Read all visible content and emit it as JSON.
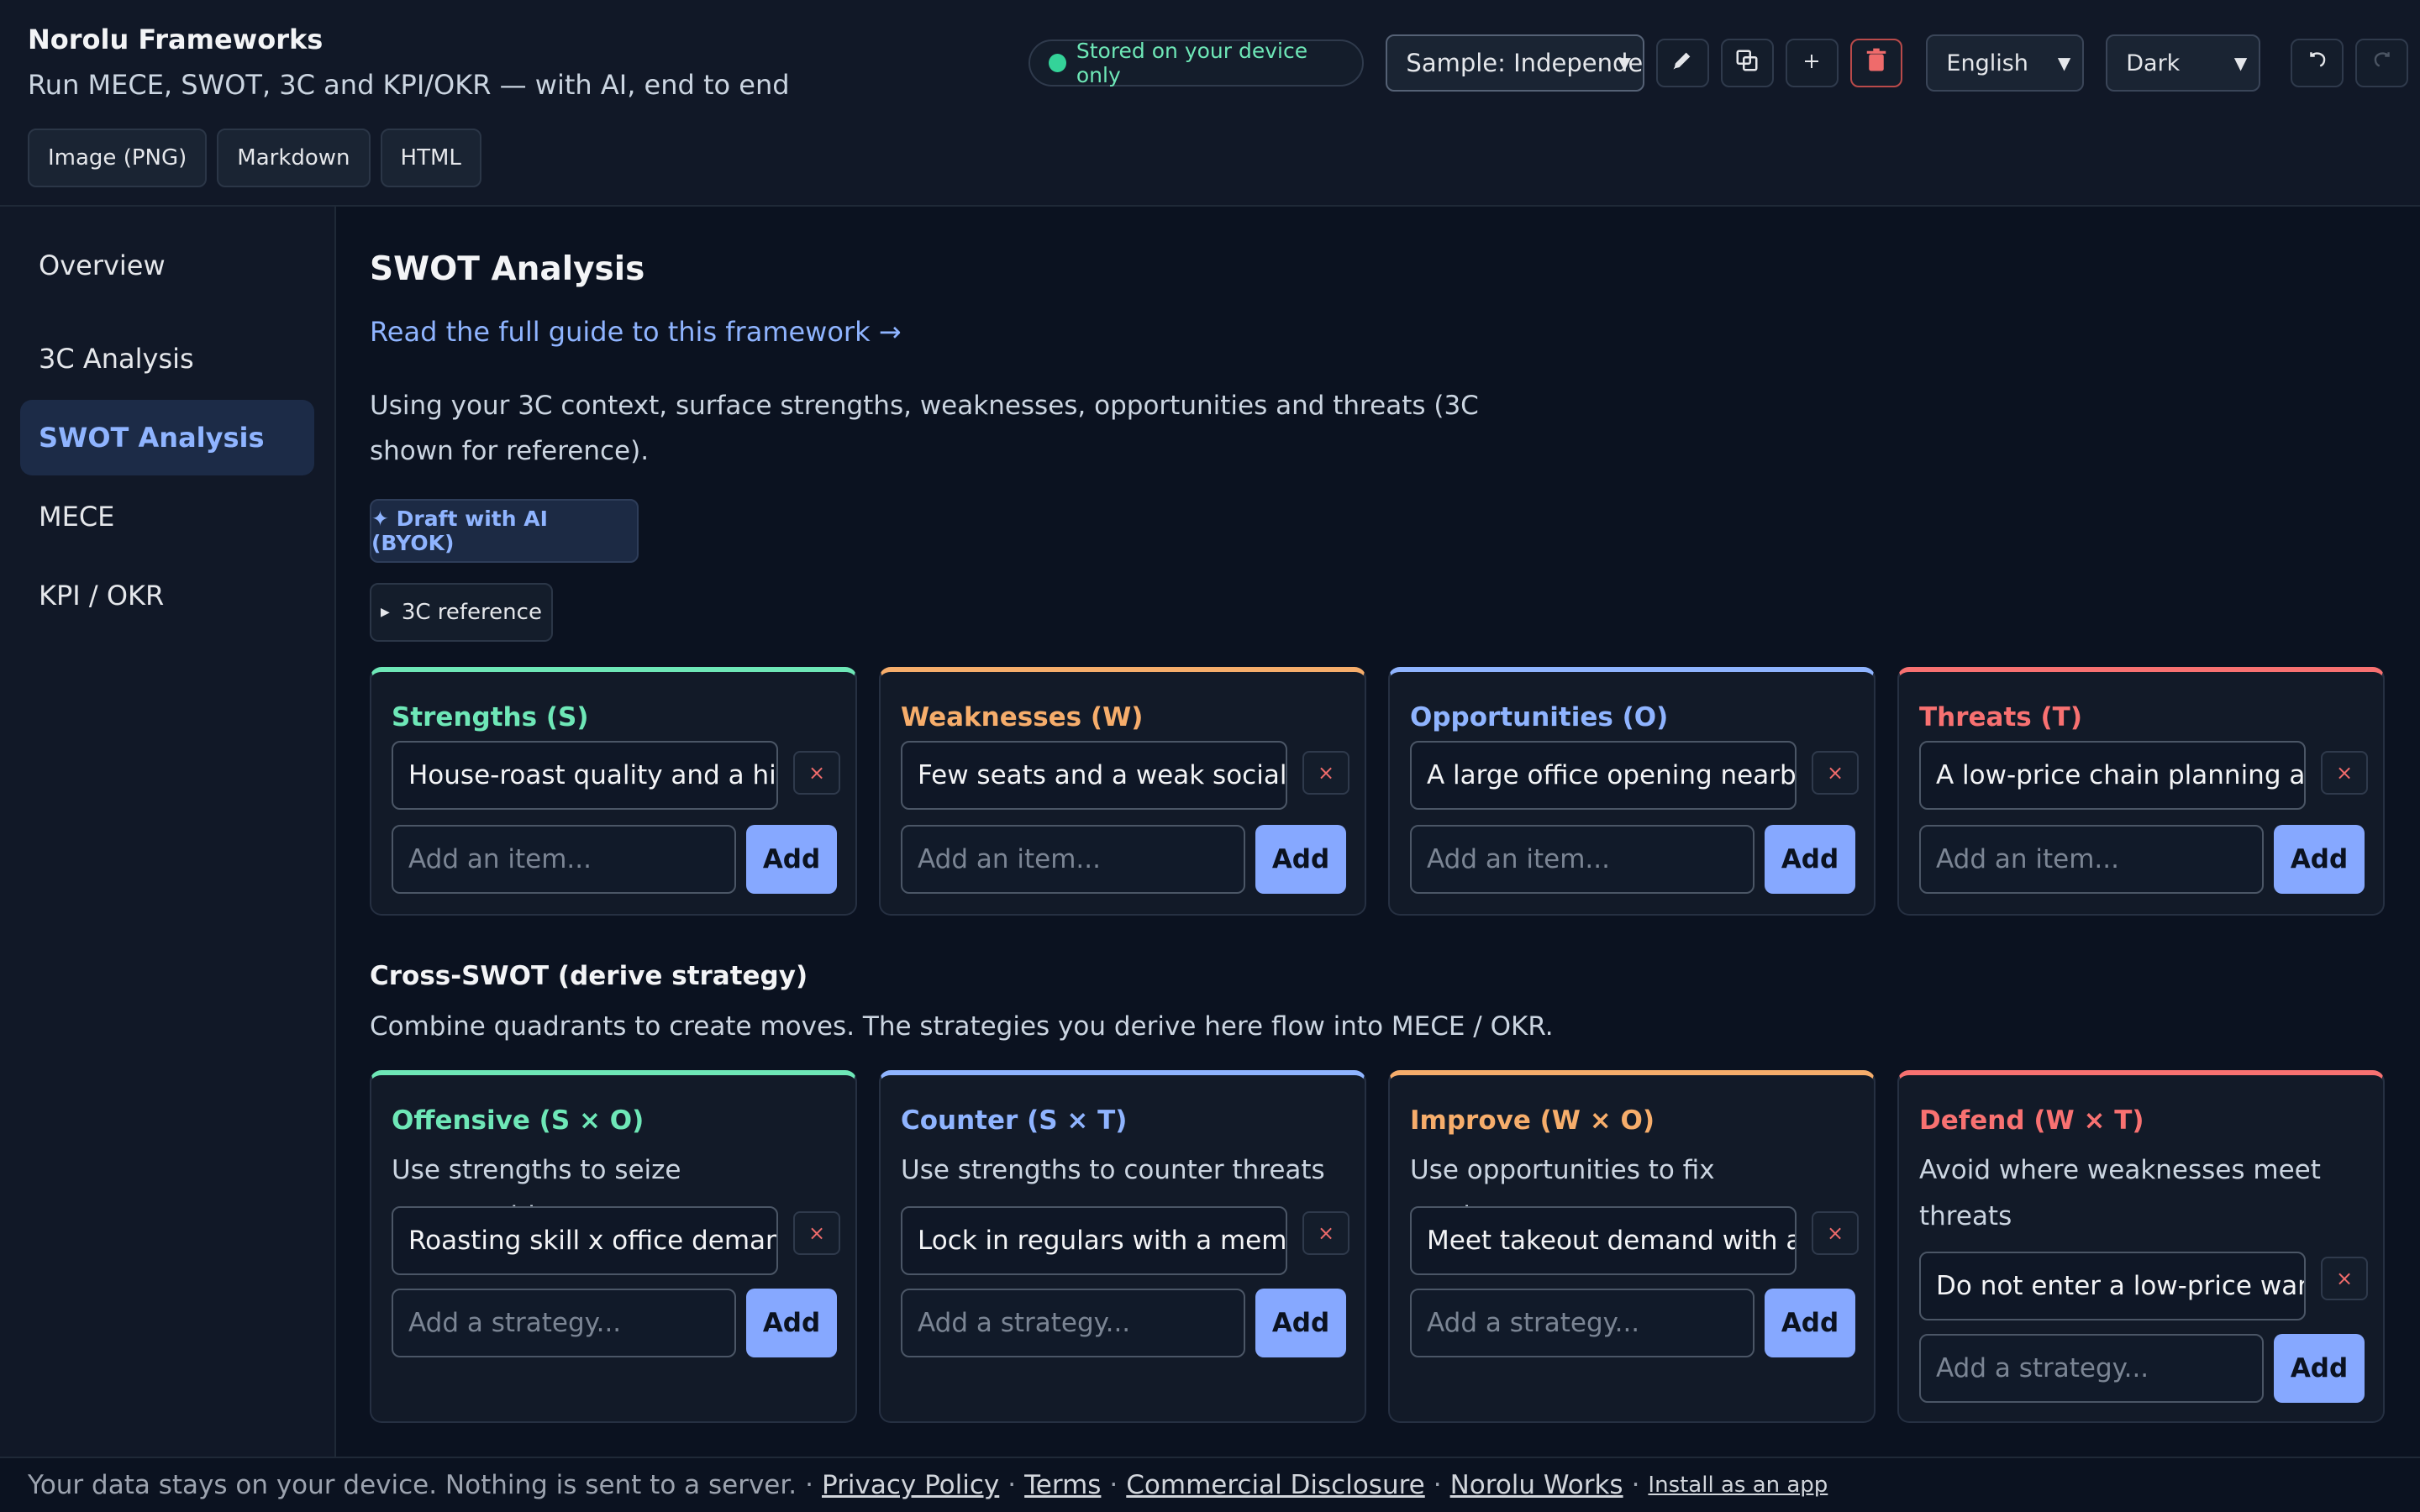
{
  "app": {
    "title": "Norolu Frameworks",
    "subtitle": "Run MECE, SWOT, 3C and KPI/OKR — with AI, end to end"
  },
  "export": {
    "png": "Image (PNG)",
    "markdown": "Markdown",
    "html": "HTML"
  },
  "header": {
    "storage_badge": "Stored on your device only",
    "sample_selected": "Sample: Independent",
    "language_selected": "English",
    "theme_selected": "Dark",
    "icons": {
      "edit": "pencil-icon",
      "duplicate": "duplicate-icon",
      "add": "plus-icon",
      "delete": "trash-icon",
      "undo": "undo-icon",
      "redo": "redo-icon"
    }
  },
  "sidebar": {
    "items": [
      {
        "label": "Overview"
      },
      {
        "label": "3C Analysis"
      },
      {
        "label": "SWOT Analysis",
        "active": true
      },
      {
        "label": "MECE"
      },
      {
        "label": "KPI / OKR"
      }
    ]
  },
  "main": {
    "title": "SWOT Analysis",
    "guide_link": "Read the full guide to this framework →",
    "intro": "Using your 3C context, surface strengths, weaknesses, opportunities and threats (3C shown for reference).",
    "ai_button": "✦ Draft with AI (BYOK)",
    "ref_toggle": "3C reference",
    "add_label": "Add",
    "remove_glyph": "×",
    "quadrants": [
      {
        "title": "Strengths (S)",
        "color": "#6ee7b7",
        "item": "House-roast quality and a high repeat rate",
        "placeholder": "Add an item..."
      },
      {
        "title": "Weaknesses (W)",
        "color": "#f6ad6b",
        "item": "Few seats and a weak social media presence",
        "placeholder": "Add an item..."
      },
      {
        "title": "Opportunities (O)",
        "color": "#8fb4ff",
        "item": "A large office opening nearby",
        "placeholder": "Add an item..."
      },
      {
        "title": "Threats (T)",
        "color": "#f87171",
        "item": "A low-price chain planning a store nearby",
        "placeholder": "Add an item..."
      }
    ],
    "cross": {
      "title": "Cross-SWOT (derive strategy)",
      "desc": "Combine quadrants to create moves. The strategies you derive here flow into MECE / OKR.",
      "cards": [
        {
          "title": "Offensive (S × O)",
          "color": "#6ee7b7",
          "desc": "Use strengths to seize opportunities",
          "item": "Roasting skill x office demand: bean subscriptions",
          "placeholder": "Add a strategy..."
        },
        {
          "title": "Counter (S × T)",
          "color": "#8fb4ff",
          "desc": "Use strengths to counter threats",
          "item": "Lock in regulars with a membership program",
          "placeholder": "Add a strategy..."
        },
        {
          "title": "Improve (W × O)",
          "color": "#f6ad6b",
          "desc": "Use opportunities to fix weaknesses",
          "item": "Meet takeout demand with app ordering",
          "placeholder": "Add a strategy..."
        },
        {
          "title": "Defend (W × T)",
          "color": "#f87171",
          "desc": "Avoid where weaknesses meet threats",
          "item": "Do not enter a low-price war on coffee",
          "placeholder": "Add a strategy..."
        }
      ]
    }
  },
  "footer": {
    "text": "Your data stays on your device. Nothing is sent to a server.",
    "links": [
      "Privacy Policy",
      "Terms",
      "Commercial Disclosure",
      "Norolu Works"
    ],
    "install": "Install as an app"
  }
}
